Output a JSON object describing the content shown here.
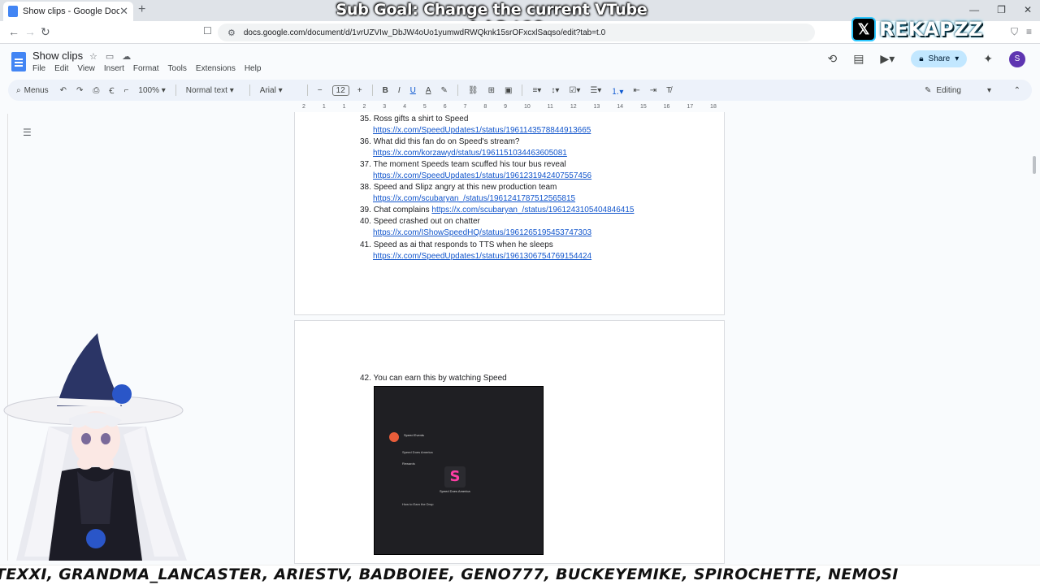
{
  "stream_overlay": {
    "goal_text": "Sub Goal: Change the current VTube model  3 / 10",
    "social_handle": "REKAPZZ",
    "social_icon": "x-icon",
    "ticker": "TEXXI, GRANDMA_LANCASTER, ARIESTV, BADBOIEE, GENO777, BUCKEYEMIKE, SPIROCHETTE, NEMOSI"
  },
  "browser": {
    "tab_title": "Show clips - Google Docs",
    "url": "docs.google.com/document/d/1vrUZVIw_DbJW4oUo1yumwdRWQknk15srOFxcxlSaqso/edit?tab=t.0"
  },
  "docs": {
    "title": "Show clips",
    "menu": [
      "File",
      "Edit",
      "View",
      "Insert",
      "Format",
      "Tools",
      "Extensions",
      "Help"
    ],
    "share_label": "Share",
    "avatar_letter": "S",
    "toolbar": {
      "menus_label": "Menus",
      "zoom": "100%",
      "style": "Normal text",
      "font": "Arial",
      "font_size": "12",
      "mode": "Editing"
    },
    "ruler_marks": [
      "2",
      "1",
      "1",
      "2",
      "3",
      "4",
      "5",
      "6",
      "7",
      "8",
      "9",
      "10",
      "11",
      "12",
      "13",
      "14",
      "15",
      "16",
      "17",
      "18"
    ]
  },
  "document": {
    "items_page1": [
      {
        "num": "35.",
        "text": "Ross gifts a shirt to Speed",
        "link": "https://x.com/SpeedUpdates1/status/1961143578844913665"
      },
      {
        "num": "36.",
        "text": "What did this fan do on Speed's stream?",
        "link": "https://x.com/korzawyd/status/1961151034463605081"
      },
      {
        "num": "37.",
        "text": "The moment Speeds team scuffed his tour bus reveal",
        "link": "https://x.com/SpeedUpdates1/status/1961231942407557456"
      },
      {
        "num": "38.",
        "text": "Speed and Slipz angry at this new production team",
        "link": "https://x.com/scubaryan_/status/1961241787512565815"
      },
      {
        "num": "39.",
        "text": "Chat complains",
        "inline_link": "https://x.com/scubaryan_/status/1961243105404846415"
      },
      {
        "num": "40.",
        "text": "Speed crashed out on chatter",
        "link": "https://x.com/IShowSpeedHQ/status/1961265195453747303"
      },
      {
        "num": "41.",
        "text": "Speed as ai that responds to TTS when he sleeps",
        "link": "https://x.com/SpeedUpdates1/status/1961306754769154424"
      }
    ],
    "item_page2": {
      "num": "42.",
      "text": "You can earn this by watching Speed"
    },
    "embedded_image": {
      "channel": "Speed Events",
      "drop_name": "Speed Does America",
      "rewards_label": "Rewards",
      "reward_name": "Speed Does America",
      "how_to": "How to Earn the Drop"
    }
  }
}
